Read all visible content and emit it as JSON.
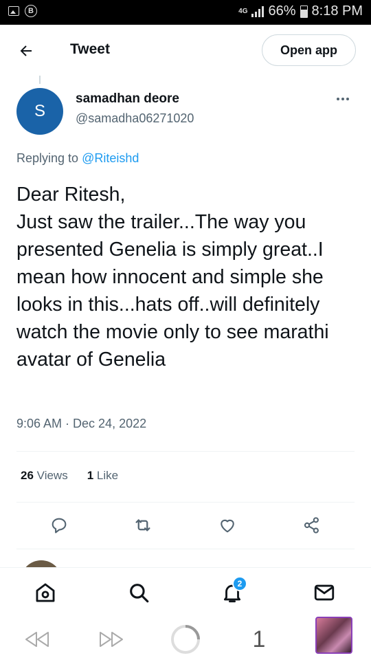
{
  "status_bar": {
    "network": "4G",
    "battery_percent": "66%",
    "battery_level": 0.66,
    "time": "8:18 PM",
    "icons": [
      "image-icon",
      "b-circle-icon",
      "signal-icon",
      "battery-icon"
    ]
  },
  "header": {
    "title": "Tweet",
    "open_app_label": "Open app",
    "back_icon": "arrow-left-icon"
  },
  "tweet": {
    "avatar_letter": "S",
    "avatar_color": "#1a63a8",
    "display_name": "samadhan deore",
    "handle": "@samadha06271020",
    "replying_prefix": "Replying to ",
    "replying_to": "@Riteishd",
    "text": "Dear Ritesh,\nJust saw the trailer...The way you presented Genelia is simply great..I mean how innocent and simple she looks in this...hats off..will definitely watch the movie only to see marathi avatar of Genelia",
    "timestamp": "9:06 AM · Dec 24, 2022",
    "views_count": "26",
    "views_label": "Views",
    "likes_count": "1",
    "likes_label": "Like"
  },
  "actions": [
    "reply-icon",
    "retweet-icon",
    "like-icon",
    "share-icon"
  ],
  "bottom_nav": {
    "items": [
      "home-icon",
      "search-icon",
      "notifications-icon",
      "messages-icon"
    ],
    "notification_badge": "2"
  },
  "browser_bar": {
    "tab_count": "1"
  },
  "colors": {
    "accent": "#1d9bf0",
    "text_primary": "#0f1419",
    "text_secondary": "#536471"
  }
}
